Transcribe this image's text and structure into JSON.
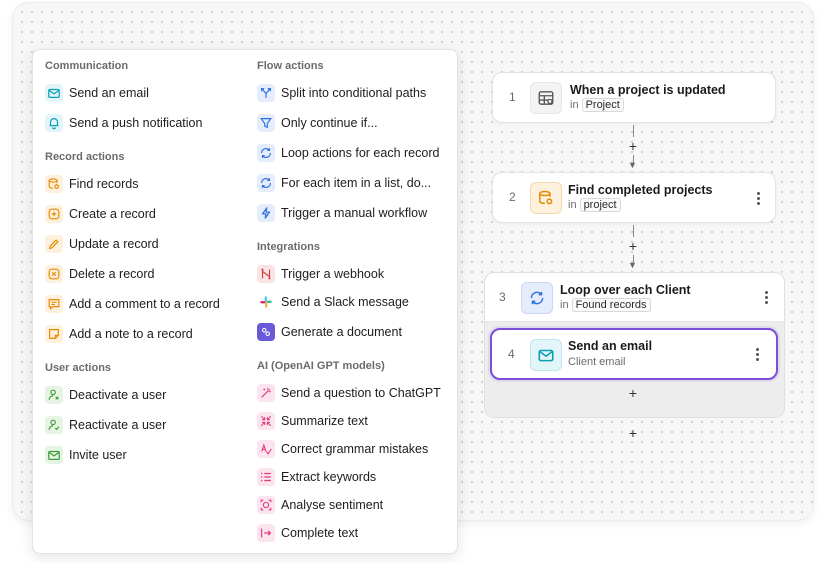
{
  "menu": {
    "communication": {
      "heading": "Communication",
      "items": [
        {
          "label": "Send an email",
          "icon": "mail-icon",
          "color": "#0e9fb8"
        },
        {
          "label": "Send a push notification",
          "icon": "bell-icon",
          "color": "#0e9fb8"
        }
      ]
    },
    "record_actions": {
      "heading": "Record actions",
      "items": [
        {
          "label": "Find records",
          "icon": "database-search-icon",
          "color": "#e68a00"
        },
        {
          "label": "Create a record",
          "icon": "plus-square-icon",
          "color": "#e68a00"
        },
        {
          "label": "Update a record",
          "icon": "edit-icon",
          "color": "#e68a00"
        },
        {
          "label": "Delete a record",
          "icon": "x-square-icon",
          "color": "#e68a00"
        },
        {
          "label": "Add a comment to a record",
          "icon": "comment-icon",
          "color": "#e68a00"
        },
        {
          "label": "Add a note to a record",
          "icon": "note-icon",
          "color": "#e68a00"
        }
      ]
    },
    "user_actions": {
      "heading": "User actions",
      "items": [
        {
          "label": "Deactivate a user",
          "icon": "user-x-icon",
          "color": "#3f9c3a"
        },
        {
          "label": "Reactivate a user",
          "icon": "user-check-icon",
          "color": "#3f9c3a"
        },
        {
          "label": "Invite user",
          "icon": "mail-icon",
          "color": "#3f9c3a"
        }
      ]
    },
    "flow_actions": {
      "heading": "Flow actions",
      "items": [
        {
          "label": "Split into conditional paths",
          "icon": "split-icon",
          "color": "#2f6fe0"
        },
        {
          "label": "Only continue if...",
          "icon": "filter-icon",
          "color": "#2f6fe0"
        },
        {
          "label": "Loop actions for each record",
          "icon": "loop-icon",
          "color": "#2f6fe0"
        },
        {
          "label": "For each item in a list, do...",
          "icon": "loop-icon",
          "color": "#2f6fe0"
        },
        {
          "label": "Trigger a manual workflow",
          "icon": "bolt-icon",
          "color": "#2f6fe0"
        }
      ]
    },
    "integrations": {
      "heading": "Integrations",
      "items": [
        {
          "label": "Trigger a webhook",
          "icon": "webhook-icon",
          "color": "#d63b3b"
        },
        {
          "label": "Send a Slack message",
          "icon": "slack-icon",
          "color": "#4a154b"
        },
        {
          "label": "Generate a document",
          "icon": "document-icon",
          "color": "#6a5ad6"
        }
      ]
    },
    "ai": {
      "heading": "AI (OpenAI GPT models)",
      "items": [
        {
          "label": "Send a question to ChatGPT",
          "icon": "magic-wand-icon",
          "color": "#e0397a"
        },
        {
          "label": "Summarize text",
          "icon": "compress-icon",
          "color": "#e0397a"
        },
        {
          "label": "Correct grammar mistakes",
          "icon": "grammar-icon",
          "color": "#e0397a"
        },
        {
          "label": "Extract keywords",
          "icon": "list-icon",
          "color": "#e0397a"
        },
        {
          "label": "Analyse sentiment",
          "icon": "sentiment-icon",
          "color": "#e0397a"
        },
        {
          "label": "Complete text",
          "icon": "complete-text-icon",
          "color": "#e0397a"
        }
      ]
    }
  },
  "flow": {
    "in_label": "in",
    "steps": [
      {
        "number": "1",
        "title": "When a project is updated",
        "tag": "Project",
        "icon": "table-icon"
      },
      {
        "number": "2",
        "title": "Find completed projects",
        "tag": "project",
        "icon": "database-search-icon"
      },
      {
        "number": "3",
        "title": "Loop over each Client",
        "tag": "Found records",
        "icon": "loop-icon"
      },
      {
        "number": "4",
        "title": "Send an email",
        "subtitle": "Client email",
        "icon": "mail-icon"
      }
    ],
    "add_label": "+",
    "colors": {
      "selected_border": "#7b4fd6",
      "loop_bg": "#ededed"
    }
  }
}
